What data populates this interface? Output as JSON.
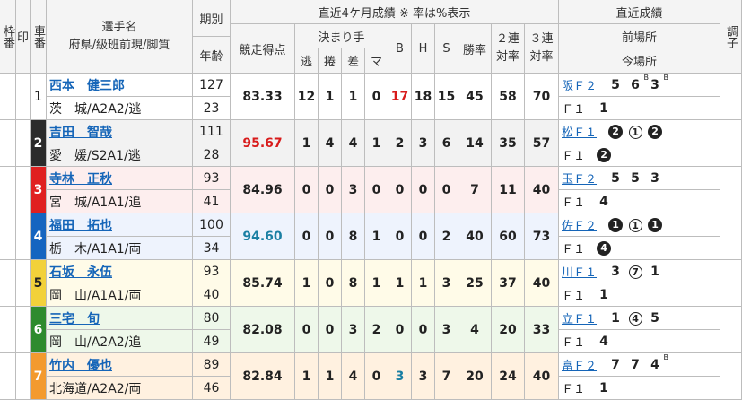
{
  "header": {
    "waku": "枠番",
    "shirushi": "印",
    "sha": "車番",
    "player_l1": "選手名",
    "player_l2": "府県/級班前現/脚質",
    "kibetsu": "期別",
    "age": "年齢",
    "stats_title": "直近4ケ月成績 ※ 率は%表示",
    "points": "競走得点",
    "kimarite": "決まり手",
    "nige": "逃",
    "makuri": "捲",
    "sashi": "差",
    "mark": "マ",
    "B": "B",
    "H": "H",
    "S": "S",
    "win": "勝率",
    "ren2_l1": "２連",
    "ren2_l2": "対率",
    "ren3_l1": "３連",
    "ren3_l2": "対率",
    "recent": "直近成績",
    "prev": "前場所",
    "curr": "今場所",
    "cho": "調子"
  },
  "riders": [
    {
      "num": "1",
      "name": "西本　健三郎",
      "pref": "茨　城/A2A2/逃",
      "ki": "127",
      "age": "23",
      "points": "83.33",
      "nige": "12",
      "makuri": "1",
      "sashi": "1",
      "mark": "0",
      "B": "17",
      "H": "18",
      "S": "15",
      "win": "45",
      "r2": "58",
      "r3": "70",
      "prev_place": "阪Ｆ２",
      "prev": [
        {
          "t": "5",
          "s": "",
          "c": ""
        },
        {
          "t": "6",
          "s": "B",
          "c": ""
        },
        {
          "t": "3",
          "s": "B",
          "c": ""
        }
      ],
      "curr_place": "Ｆ１",
      "curr": [
        {
          "t": "1",
          "s": "",
          "c": ""
        }
      ]
    },
    {
      "num": "2",
      "name": "吉田　智哉",
      "pref": "愛　媛/S2A1/逃",
      "ki": "111",
      "age": "28",
      "points": "95.67",
      "nige": "1",
      "makuri": "4",
      "sashi": "4",
      "mark": "1",
      "B": "2",
      "H": "3",
      "S": "6",
      "win": "14",
      "r2": "35",
      "r3": "57",
      "prev_place": "松Ｆ１",
      "prev": [
        {
          "t": "2",
          "s": "",
          "c": "black"
        },
        {
          "t": "1",
          "s": "",
          "c": "white"
        },
        {
          "t": "2",
          "s": "",
          "c": "black"
        }
      ],
      "curr_place": "Ｆ１",
      "curr": [
        {
          "t": "2",
          "s": "",
          "c": "black"
        }
      ]
    },
    {
      "num": "3",
      "name": "寺林　正秋",
      "pref": "宮　城/A1A1/追",
      "ki": "93",
      "age": "41",
      "points": "84.96",
      "nige": "0",
      "makuri": "0",
      "sashi": "3",
      "mark": "0",
      "B": "0",
      "H": "0",
      "S": "0",
      "win": "7",
      "r2": "11",
      "r3": "40",
      "prev_place": "玉Ｆ２",
      "prev": [
        {
          "t": "5",
          "s": "",
          "c": ""
        },
        {
          "t": "5",
          "s": "",
          "c": ""
        },
        {
          "t": "3",
          "s": "",
          "c": ""
        }
      ],
      "curr_place": "Ｆ１",
      "curr": [
        {
          "t": "4",
          "s": "",
          "c": ""
        }
      ]
    },
    {
      "num": "4",
      "name": "福田　拓也",
      "pref": "栃　木/A1A1/両",
      "ki": "100",
      "age": "34",
      "points": "94.60",
      "nige": "0",
      "makuri": "0",
      "sashi": "8",
      "mark": "1",
      "B": "0",
      "H": "0",
      "S": "2",
      "win": "40",
      "r2": "60",
      "r3": "73",
      "prev_place": "佐Ｆ２",
      "prev": [
        {
          "t": "1",
          "s": "",
          "c": "black"
        },
        {
          "t": "1",
          "s": "",
          "c": "white"
        },
        {
          "t": "1",
          "s": "",
          "c": "black"
        }
      ],
      "curr_place": "Ｆ１",
      "curr": [
        {
          "t": "4",
          "s": "",
          "c": "black"
        }
      ]
    },
    {
      "num": "5",
      "name": "石坂　永伍",
      "pref": "岡　山/A1A1/両",
      "ki": "93",
      "age": "40",
      "points": "85.74",
      "nige": "1",
      "makuri": "0",
      "sashi": "8",
      "mark": "1",
      "B": "1",
      "H": "1",
      "S": "3",
      "win": "25",
      "r2": "37",
      "r3": "40",
      "prev_place": "川Ｆ１",
      "prev": [
        {
          "t": "3",
          "s": "",
          "c": ""
        },
        {
          "t": "7",
          "s": "",
          "c": "white"
        },
        {
          "t": "1",
          "s": "",
          "c": ""
        }
      ],
      "curr_place": "Ｆ１",
      "curr": [
        {
          "t": "1",
          "s": "",
          "c": ""
        }
      ]
    },
    {
      "num": "6",
      "name": "三宅　旬",
      "pref": "岡　山/A2A2/追",
      "ki": "80",
      "age": "49",
      "points": "82.08",
      "nige": "0",
      "makuri": "0",
      "sashi": "3",
      "mark": "2",
      "B": "0",
      "H": "0",
      "S": "3",
      "win": "4",
      "r2": "20",
      "r3": "33",
      "prev_place": "立Ｆ１",
      "prev": [
        {
          "t": "1",
          "s": "",
          "c": ""
        },
        {
          "t": "4",
          "s": "",
          "c": "white"
        },
        {
          "t": "5",
          "s": "",
          "c": ""
        }
      ],
      "curr_place": "Ｆ１",
      "curr": [
        {
          "t": "4",
          "s": "",
          "c": ""
        }
      ]
    },
    {
      "num": "7",
      "name": "竹内　優也",
      "pref": "北海道/A2A2/両",
      "ki": "89",
      "age": "46",
      "points": "82.84",
      "nige": "1",
      "makuri": "1",
      "sashi": "4",
      "mark": "0",
      "B": "3",
      "H": "3",
      "S": "7",
      "win": "20",
      "r2": "24",
      "r3": "40",
      "prev_place": "富Ｆ２",
      "prev": [
        {
          "t": "7",
          "s": "",
          "c": ""
        },
        {
          "t": "7",
          "s": "",
          "c": ""
        },
        {
          "t": "4",
          "s": "B",
          "c": ""
        }
      ],
      "curr_place": "Ｆ１",
      "curr": [
        {
          "t": "1",
          "s": "",
          "c": ""
        }
      ]
    }
  ],
  "colors": {
    "rowbg": [
      "#ffffff",
      "#f2f2f2",
      "#fdeeee",
      "#eef3fd",
      "#fffbe8",
      "#eef8ea",
      "#fff1e0"
    ],
    "numbg": [
      "#ffffff",
      "#2b2b2b",
      "#e02020",
      "#1565c0",
      "#f2d13a",
      "#2e8b2e",
      "#f39a2e"
    ],
    "numfg": [
      "#222222",
      "#ffffff",
      "#ffffff",
      "#ffffff",
      "#222222",
      "#ffffff",
      "#ffffff"
    ],
    "points_red": "#d81b1b",
    "points_blue": "#1a7fa3",
    "bcount_red": "#d81b1b",
    "bcount_blue": "#1a7fa3"
  },
  "highlights": {
    "points_red_row": 1,
    "points_blue_row": 3,
    "B_red_row": 0,
    "B_blue_row": 6
  }
}
